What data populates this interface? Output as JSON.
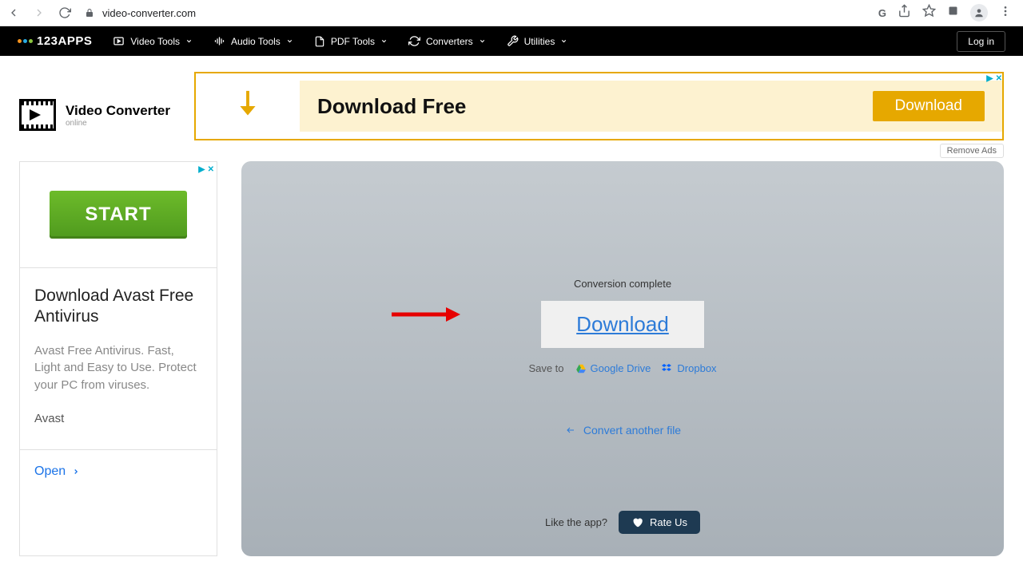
{
  "browser": {
    "url": "video-converter.com"
  },
  "topnav": {
    "brand": "123APPS",
    "items": [
      {
        "label": "Video Tools"
      },
      {
        "label": "Audio Tools"
      },
      {
        "label": "PDF Tools"
      },
      {
        "label": "Converters"
      },
      {
        "label": "Utilities"
      }
    ],
    "login": "Log in"
  },
  "app": {
    "title": "Video Converter",
    "subtitle": "online"
  },
  "banner": {
    "headline": "Download Free",
    "cta": "Download",
    "remove_ads": "Remove Ads"
  },
  "sidebar_ad": {
    "start": "START",
    "heading": "Download Avast Free Antivirus",
    "body": "Avast Free Antivirus. Fast, Light and Easy to Use. Protect your PC from viruses.",
    "brand": "Avast",
    "open": "Open"
  },
  "panel": {
    "status": "Conversion complete",
    "download": "Download",
    "save_to": "Save to",
    "gdrive": "Google Drive",
    "dropbox": "Dropbox",
    "convert_another": "Convert another file",
    "like_label": "Like the app?",
    "rate": "Rate Us"
  }
}
